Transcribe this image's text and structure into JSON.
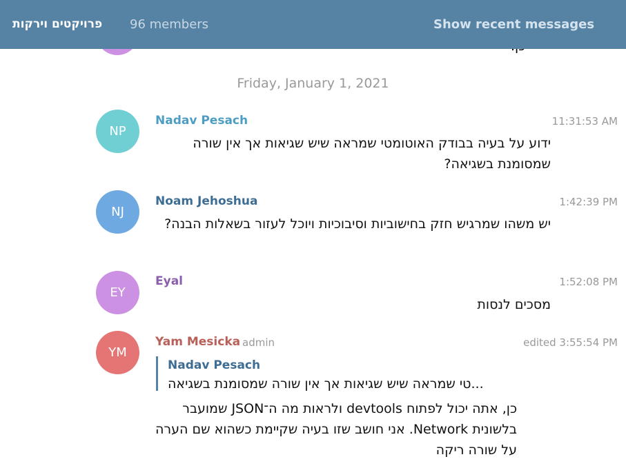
{
  "header": {
    "title": "פרויקטים וירקות",
    "members": "96 members",
    "show_recent": "Show recent messages"
  },
  "prev_message": {
    "text": "כן."
  },
  "date_separator": "Friday, January 1, 2021",
  "messages": [
    {
      "initials": "NP",
      "name": "Nadav Pesach",
      "time": "11:31:53 AM",
      "text": "ידוע על בעיה בבודק האוטומטי שמראה שיש שגיאות אך אין שורה שמסומנת בשגיאה?",
      "avatar_color": "#6fcfd3",
      "name_color": "#4e9ec4"
    },
    {
      "initials": "NJ",
      "name": "Noam Jehoshua",
      "time": "1:42:39 PM",
      "text": "יש משהו שמרגיש חזק בחישוביות וסיבוכיות ויוכל לעזור בשאלות הבנה?",
      "avatar_color": "#6fa9e2",
      "name_color": "#3e6d93"
    },
    {
      "initials": "EY",
      "name": "Eyal",
      "time": "1:52:08 PM",
      "text": "מסכים לנסות",
      "avatar_color": "#cd91e4",
      "name_color": "#8a5fae"
    },
    {
      "initials": "YM",
      "name": "Yam Mesicka",
      "badge": "admin",
      "time": "edited 3:55:54 PM",
      "reply": {
        "name": "Nadav Pesach",
        "text": "...טי שמראה שיש שגיאות אך אין שורה שמסומנת בשגיאה"
      },
      "text": "כן, אתה יכול לפתוח devtools ולראות מה ה־JSON שמועבר בלשונית Network. אני חושב שזו בעיה שקיימת כשהוא שם הערה על שורה ריקה",
      "avatar_color": "#e57474",
      "name_color": "#b9605a"
    }
  ]
}
